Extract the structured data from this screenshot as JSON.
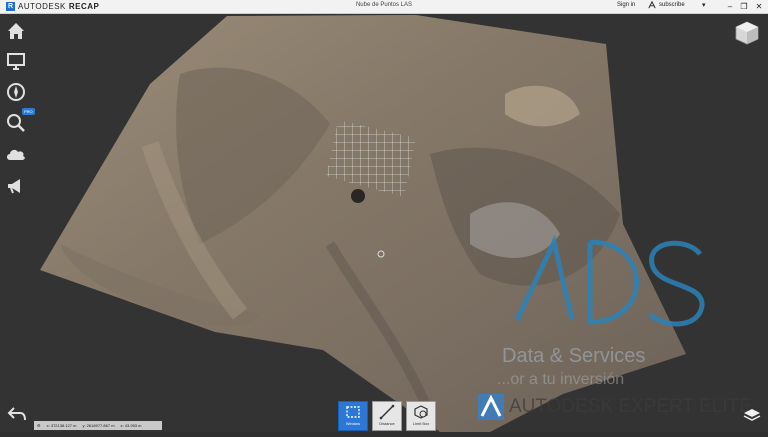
{
  "titlebar": {
    "brand": "AUTODESK",
    "product": "RECAP",
    "document": "Nube de Puntos LAS",
    "signin": "Sign in",
    "subscribe": "subscribe",
    "minimize": "–",
    "restore": "❐",
    "close": "✕",
    "dropdown": "▾"
  },
  "sidebar": {
    "items": [
      {
        "name": "home",
        "icon": "home-icon"
      },
      {
        "name": "display",
        "icon": "monitor-icon"
      },
      {
        "name": "navigate",
        "icon": "compass-icon"
      },
      {
        "name": "search",
        "icon": "search-icon",
        "badge": "PRO"
      },
      {
        "name": "cloud",
        "icon": "cloud-icon"
      },
      {
        "name": "announce",
        "icon": "megaphone-icon"
      }
    ]
  },
  "toolbar": {
    "tools": [
      {
        "label": "Window",
        "icon": "window-select-icon",
        "active": true
      },
      {
        "label": "Distance",
        "icon": "distance-icon",
        "active": false
      },
      {
        "label": "Limit Box",
        "icon": "limit-box-icon",
        "active": false
      }
    ]
  },
  "coords": {
    "x_label": "x:",
    "x": "372138.127",
    "x_unit": "m",
    "y_label": "y:",
    "y": "2618977.867",
    "y_unit": "m",
    "z_label": "z:",
    "z": "43.953",
    "z_unit": "m"
  },
  "watermark": {
    "logo_text": "ADS",
    "line1": "Data & Services",
    "line2": "...or a tu inversión",
    "expert": "AUTODESK  EXPERT ELITE"
  },
  "colors": {
    "accent": "#2b78d6",
    "terrain": "#8a7d6c",
    "background": "#333333"
  }
}
